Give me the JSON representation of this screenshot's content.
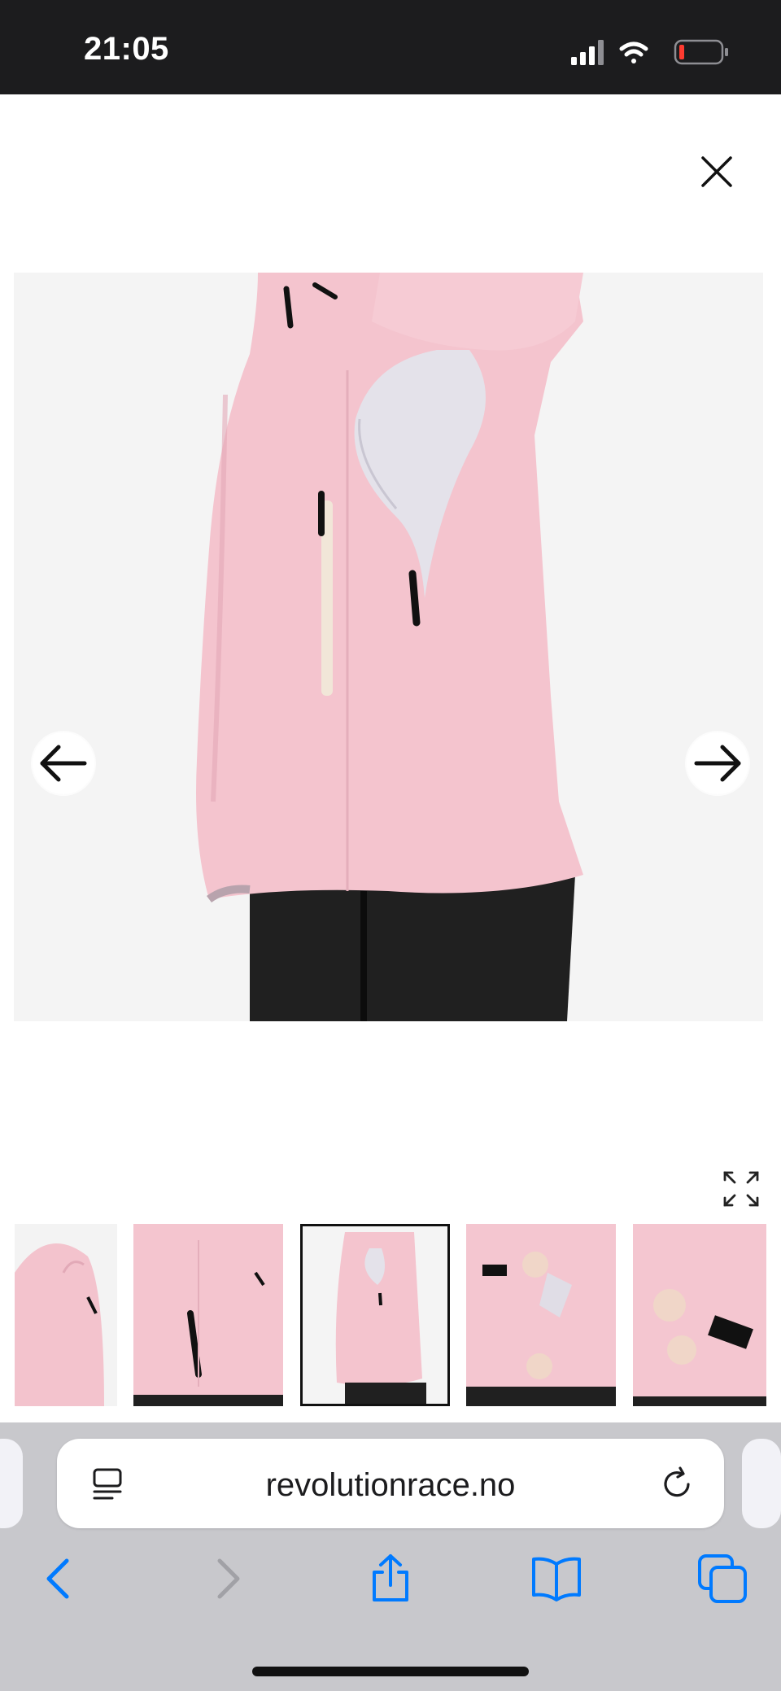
{
  "status_bar": {
    "time": "21:05",
    "icons": [
      "signal-icon",
      "wifi-icon",
      "battery-low-icon"
    ],
    "battery_color": "#ff3b30"
  },
  "viewer": {
    "close_icon": "close-icon",
    "prev_icon": "arrow-left-icon",
    "next_icon": "arrow-right-icon",
    "expand_icon": "expand-icon",
    "main_image_color": "#f4c6d0",
    "selected_thumbnail": 3,
    "thumbnails": [
      {
        "index": 1,
        "subject": "jacket-hood-back"
      },
      {
        "index": 2,
        "subject": "jacket-front-pocket"
      },
      {
        "index": 3,
        "subject": "jacket-side-vent"
      },
      {
        "index": 4,
        "subject": "jacket-inner-pocket"
      },
      {
        "index": 5,
        "subject": "jacket-cuff"
      }
    ]
  },
  "browser": {
    "url": "revolutionrace.no",
    "reader_icon": "reader-icon",
    "reload_icon": "reload-icon",
    "toolbar": [
      "back-icon",
      "forward-icon",
      "share-icon",
      "bookmarks-icon",
      "tabs-icon"
    ],
    "accent": "#007aff"
  }
}
